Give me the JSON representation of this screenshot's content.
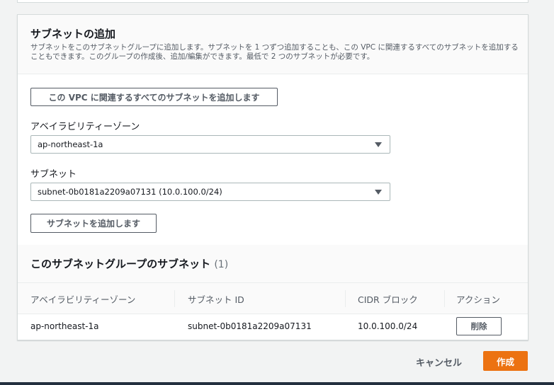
{
  "add_subnets": {
    "title": "サブネットの追加",
    "description": "サブネットをこのサブネットグループに追加します。サブネットを 1 つずつ追加することも、この VPC に関連するすべてのサブネットを追加することもできます。このグループの作成後、追加/編集ができます。最低で 2 つのサブネットが必要です。",
    "add_all_button": "この VPC に関連するすべてのサブネットを追加します",
    "az_label": "アベイラビリティーゾーン",
    "az_value": "ap-northeast-1a",
    "subnet_label": "サブネット",
    "subnet_value": "subnet-0b0181a2209a07131 (10.0.100.0/24)",
    "add_subnet_button": "サブネットを追加します"
  },
  "group_subnets": {
    "title": "このサブネットグループのサブネット",
    "count": "(1)",
    "columns": [
      "アベイラビリティーゾーン",
      "サブネット ID",
      "CIDR ブロック",
      "アクション"
    ],
    "rows": [
      {
        "az": "ap-northeast-1a",
        "subnet_id": "subnet-0b0181a2209a07131",
        "cidr": "10.0.100.0/24",
        "action": "削除"
      }
    ]
  },
  "footer": {
    "cancel": "キャンセル",
    "create": "作成"
  },
  "colors": {
    "primary_button": "#ec7211",
    "text": "#16191f",
    "secondary_text": "#545b64"
  }
}
